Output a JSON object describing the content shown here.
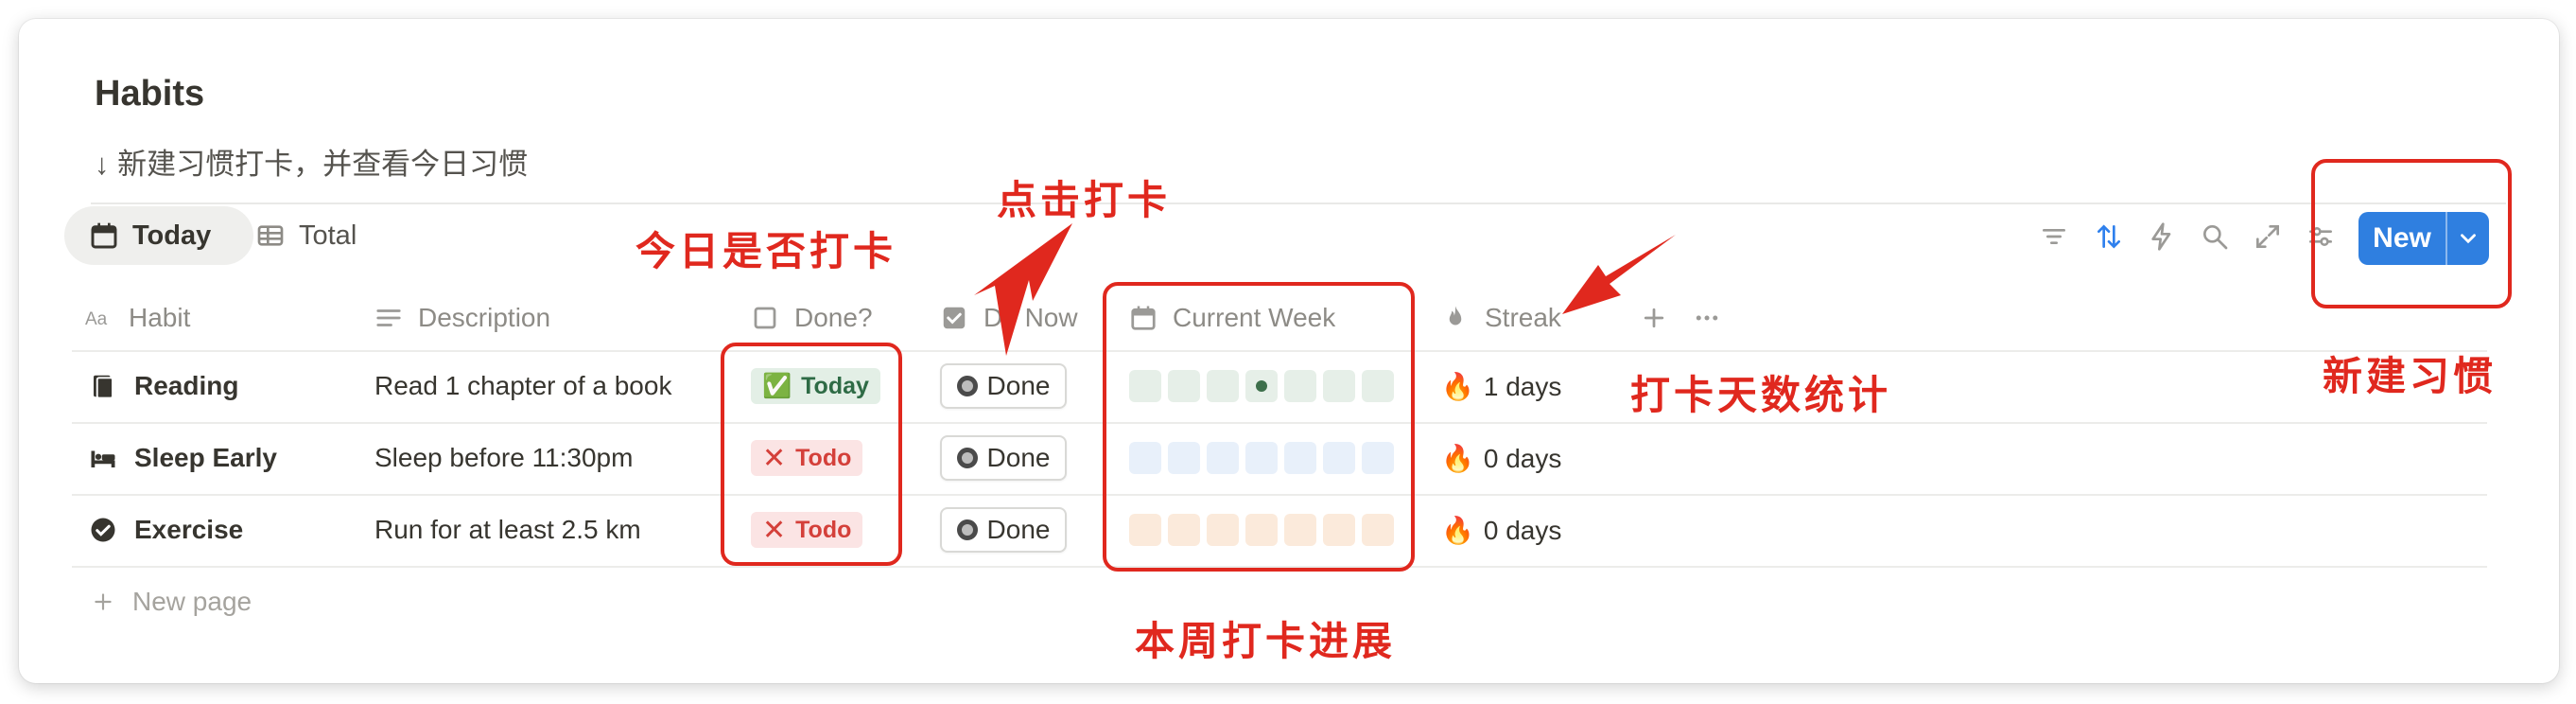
{
  "page": {
    "title": "Habits",
    "subtitle": "↓ 新建习惯打卡，并查看今日习惯"
  },
  "views": [
    {
      "label": "Today",
      "icon": "calendar-icon",
      "active": true
    },
    {
      "label": "Total",
      "icon": "table-icon",
      "active": false
    }
  ],
  "toolbar": {
    "icons": [
      "filter-icon",
      "sort-icon",
      "automation-icon",
      "search-icon",
      "expand-icon",
      "settings-icon"
    ],
    "new_label": "New"
  },
  "columns": [
    {
      "label": "Habit",
      "icon": "text-type-icon"
    },
    {
      "label": "Description",
      "icon": "lines-icon"
    },
    {
      "label": "Done?",
      "icon": "checkbox-icon"
    },
    {
      "label": "Do Now",
      "icon": "checked-checkbox-icon"
    },
    {
      "label": "Current Week",
      "icon": "calendar-icon"
    },
    {
      "label": "Streak",
      "icon": "fire-icon"
    }
  ],
  "rows": [
    {
      "habit": "Reading",
      "icon": "book-icon",
      "description": "Read 1 chapter of a book",
      "status": "Today",
      "status_icon": "✅",
      "button": "Done",
      "streak": "1 days",
      "week_color": "#e6efe8",
      "week_marked_day": 3
    },
    {
      "habit": "Sleep Early",
      "icon": "bed-icon",
      "description": "Sleep before 11:30pm",
      "status": "Todo",
      "status_icon": "✕",
      "button": "Done",
      "streak": "0 days",
      "week_color": "#e8f0fa",
      "week_marked_day": null
    },
    {
      "habit": "Exercise",
      "icon": "check-circle-icon",
      "description": "Run for at least 2.5 km",
      "status": "Todo",
      "status_icon": "✕",
      "button": "Done",
      "streak": "0 days",
      "week_color": "#fbeadb",
      "week_marked_day": null
    }
  ],
  "new_page_label": "New page",
  "annotations": {
    "done_label": "今日是否打卡",
    "click_label": "点击打卡",
    "week_label": "本周打卡进展",
    "streak_label": "打卡天数统计",
    "new_label": "新建习惯"
  },
  "colors": {
    "accent": "#2f7fe0",
    "annotation": "#e0281e",
    "today_badge": "#e3efe6",
    "todo_badge": "#fbe4e4"
  }
}
